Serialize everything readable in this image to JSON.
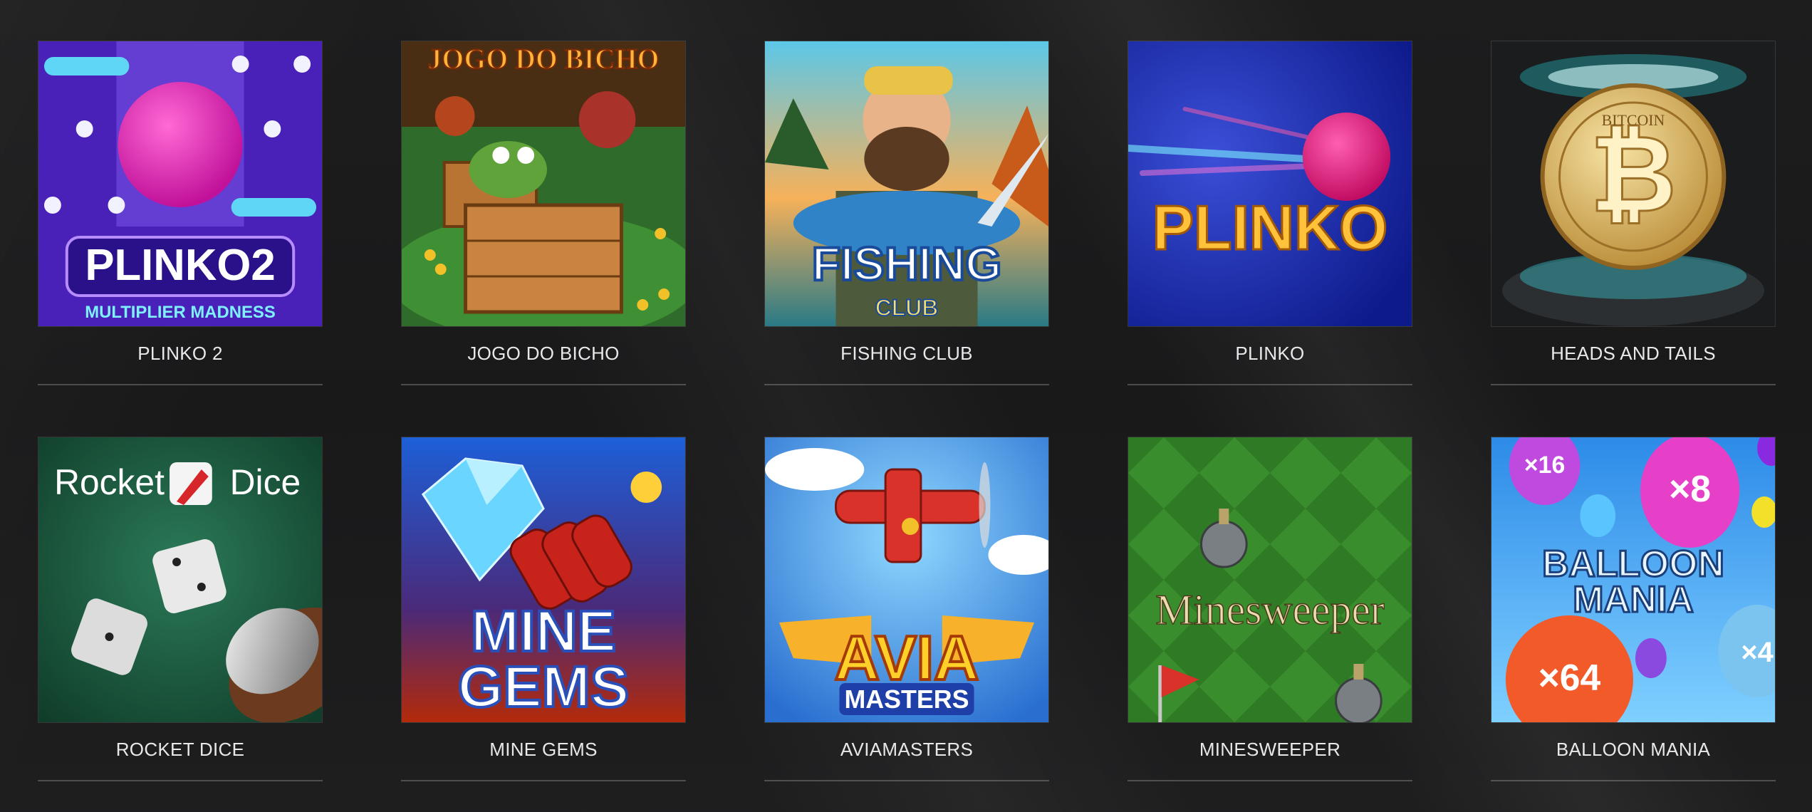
{
  "games": [
    {
      "title": "PLINKO 2",
      "thumb_text": [
        "PLINKO2",
        "MULTIPLIER MADNESS"
      ],
      "icon": "plinko2-thumbnail"
    },
    {
      "title": "JOGO DO BICHO",
      "thumb_text": [
        "JOGO DO BICHO"
      ],
      "icon": "jogo-do-bicho-thumbnail"
    },
    {
      "title": "FISHING CLUB",
      "thumb_text": [
        "FISHING",
        "CLUB"
      ],
      "icon": "fishing-club-thumbnail"
    },
    {
      "title": "PLINKO",
      "thumb_text": [
        "PLINKO"
      ],
      "icon": "plinko-thumbnail"
    },
    {
      "title": "HEADS AND TAILS",
      "thumb_text": [
        "BITCOIN"
      ],
      "icon": "heads-and-tails-thumbnail"
    },
    {
      "title": "ROCKET DICE",
      "thumb_text": [
        "Rocket",
        "Dice"
      ],
      "icon": "rocket-dice-thumbnail"
    },
    {
      "title": "MINE GEMS",
      "thumb_text": [
        "MINE",
        "GEMS"
      ],
      "icon": "mine-gems-thumbnail"
    },
    {
      "title": "AVIAMASTERS",
      "thumb_text": [
        "AVIA",
        "MASTERS"
      ],
      "icon": "aviamasters-thumbnail"
    },
    {
      "title": "MINESWEEPER",
      "thumb_text": [
        "Minesweeper"
      ],
      "icon": "minesweeper-thumbnail"
    },
    {
      "title": "BALLOON MANIA",
      "thumb_text": [
        "BALLOON",
        "MANIA",
        "×16",
        "×8",
        "×64",
        "×4"
      ],
      "icon": "balloon-mania-thumbnail"
    }
  ]
}
